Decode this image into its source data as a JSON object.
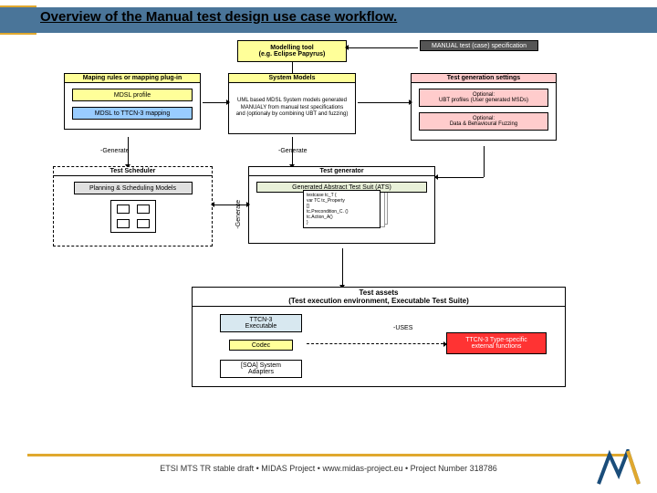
{
  "title": "Overview of the Manual test design use case workflow.",
  "modeling_tool": {
    "header": "Modelling tool\n(e.g. Eclipse Papyrus)"
  },
  "manual_spec": {
    "label": "MANUAL test (case) specification"
  },
  "mapping_rules": {
    "header": "Maping rules or mapping plug-in",
    "profile": "MDSL profile",
    "mapping": "MDSL to TTCN-3 mapping"
  },
  "system_models": {
    "header": "System Models",
    "body": "UML based MDSL System models generated\nMANUALY from manual test specifications\nand (optionaly by combining UBT and fuzzing)"
  },
  "test_gen_settings": {
    "header": "Test generation settings",
    "opt1": "Optional:\nUBT profiles (User generated MSDs)",
    "opt2": "Optional:\nData & Behavioural Fuzzing"
  },
  "generate_labels": {
    "g1": "-Generate",
    "g2": "-Generate",
    "g3": "-Generate"
  },
  "test_scheduler": {
    "header": "Test Scheduler",
    "models": "Planning & Scheduling Models"
  },
  "test_generator": {
    "header": "Test generator",
    "ats": "Generated Abstract Test Suit (ATS)",
    "testcase": "testcase tc_T {\n  var TC tc_Property\n  []\n  tc.Precondition_C. ()\n  tc.Action_A()\n}"
  },
  "test_assets": {
    "header": "Test assets\n(Test execution environment, Executable Test Suite)",
    "exec": "TTCN-3\nExecutable",
    "codec": "Codec",
    "adapter": "[SOA] System\nAdapters",
    "uses": "-USES",
    "ttcn3": "TTCN-3 Type-specific\nexternal functions"
  },
  "footer": "ETSI MTS TR stable draft • MIDAS Project • www.midas-project.eu • Project Number 318786"
}
